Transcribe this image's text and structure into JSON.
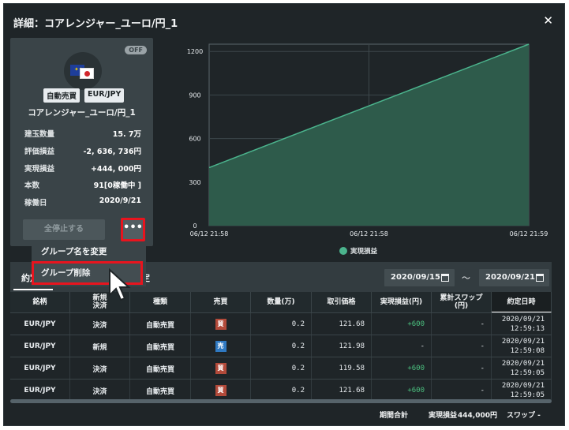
{
  "window": {
    "title": "詳細：コアレンジャー_ユーロ/円_1"
  },
  "card": {
    "status_badge": "OFF",
    "tags": [
      "自動売買",
      "EUR/JPY"
    ],
    "name": "コアレンジャー_ユーロ/円_1",
    "stats": [
      {
        "label": "建玉数量",
        "value": "15. 7万"
      },
      {
        "label": "評価損益",
        "value": "-2, 636, 736円"
      },
      {
        "label": "実現損益",
        "value": "+444, 000円"
      },
      {
        "label": "本数",
        "value": "91[0稼働中 ]"
      },
      {
        "label": "稼働日",
        "value": "2020/9/21"
      }
    ],
    "stop_all_label": "全停止する",
    "more_label": "•••"
  },
  "dropdown": {
    "items": [
      "グループ名を変更",
      "グループ削除"
    ]
  },
  "chart_data": {
    "type": "area",
    "x": [
      "06/12 21:58",
      "06/12 21:59"
    ],
    "x_ticks": [
      "06/12 21:58",
      "06/12 21:58",
      "06/12 21:59"
    ],
    "y_ticks": [
      "0",
      "300",
      "600",
      "900",
      "1200"
    ],
    "ylim": [
      0,
      1250
    ],
    "series": [
      {
        "name": "実現損益",
        "values": [
          400,
          1250
        ]
      }
    ],
    "legend": "bottom",
    "grid": true,
    "colors": {
      "fill": "#2e5b4b",
      "line": "#4bb48d"
    }
  },
  "tabs": {
    "active": "約定",
    "other": "定"
  },
  "date_range": {
    "from": "2020/09/15",
    "to": "2020/09/21",
    "separator": "～"
  },
  "table": {
    "headers": [
      "銘柄",
      "新規\n決済",
      "種類",
      "売買",
      "数量(万)",
      "取引価格",
      "実現損益(円)",
      "累計スワップ\n(円)",
      "約定日時"
    ],
    "rows": [
      {
        "symbol": "EUR/JPY",
        "type1": "決済",
        "kind": "自動売買",
        "side": "買",
        "side_type": "buy",
        "qty": "0.2",
        "price": "121.68",
        "pnl": "+600",
        "swap": "-",
        "date": "2020/09/21",
        "time": "12:59:13"
      },
      {
        "symbol": "EUR/JPY",
        "type1": "新規",
        "kind": "自動売買",
        "side": "売",
        "side_type": "sell",
        "qty": "0.2",
        "price": "121.98",
        "pnl": "-",
        "swap": "-",
        "date": "2020/09/21",
        "time": "12:59:08"
      },
      {
        "symbol": "EUR/JPY",
        "type1": "決済",
        "kind": "自動売買",
        "side": "買",
        "side_type": "buy",
        "qty": "0.2",
        "price": "119.58",
        "pnl": "+600",
        "swap": "-",
        "date": "2020/09/21",
        "time": "12:59:05"
      },
      {
        "symbol": "EUR/JPY",
        "type1": "決済",
        "kind": "自動売買",
        "side": "買",
        "side_type": "buy",
        "qty": "0.2",
        "price": "121.68",
        "pnl": "+600",
        "swap": "-",
        "date": "2020/09/21",
        "time": "12:59:05"
      }
    ]
  },
  "footer": {
    "period_total_label": "期間合計",
    "pnl_label": "実現損益",
    "pnl_value": "444,000円",
    "swap_label": "スワップ -"
  }
}
